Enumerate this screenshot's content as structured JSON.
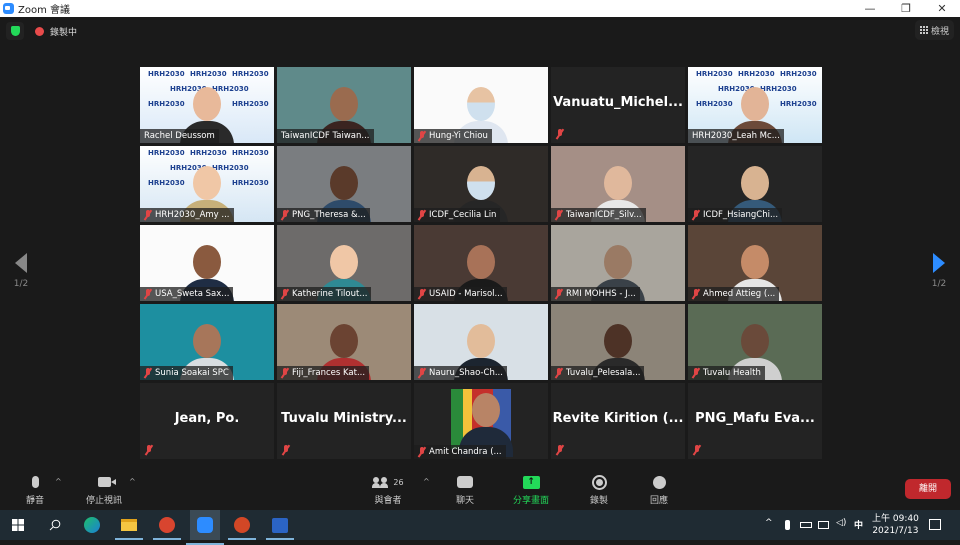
{
  "window": {
    "title": "Zoom 會議",
    "minimize": "—",
    "maximize": "❐",
    "close": "✕"
  },
  "topbar": {
    "recording_label": "錄製中",
    "view_label": "檢視"
  },
  "pagination": {
    "left": "1/2",
    "right": "1/2"
  },
  "tiles": [
    {
      "name": "Rachel Deussom",
      "muted": false,
      "video": true,
      "active": false
    },
    {
      "name": "TaiwanICDF Taiwan...",
      "muted": false,
      "video": true,
      "active": false
    },
    {
      "name": "Hung-Yi Chiou",
      "muted": true,
      "video": true,
      "active": false
    },
    {
      "name": "Vanuatu_Michel...",
      "muted": true,
      "video": false,
      "active": false
    },
    {
      "name": "HRH2030_Leah Mc...",
      "muted": false,
      "video": true,
      "active": true
    },
    {
      "name": "HRH2030_Amy ...",
      "muted": true,
      "video": true,
      "active": false
    },
    {
      "name": "PNG_Theresa &...",
      "muted": true,
      "video": true,
      "active": false
    },
    {
      "name": "ICDF_Cecilia Lin",
      "muted": true,
      "video": true,
      "active": false
    },
    {
      "name": "TaiwanICDF_Silv...",
      "muted": true,
      "video": true,
      "active": false
    },
    {
      "name": "ICDF_HsiangChi...",
      "muted": true,
      "video": true,
      "active": false
    },
    {
      "name": "USA_Sweta Sax...",
      "muted": true,
      "video": true,
      "active": false
    },
    {
      "name": "Katherine Tilout...",
      "muted": true,
      "video": true,
      "active": false
    },
    {
      "name": "USAID - Marisol...",
      "muted": true,
      "video": true,
      "active": false
    },
    {
      "name": "RMI MOHHS - J...",
      "muted": true,
      "video": true,
      "active": false
    },
    {
      "name": "Ahmed Attieg (...",
      "muted": true,
      "video": true,
      "active": false
    },
    {
      "name": "Sunia Soakai SPC",
      "muted": true,
      "video": true,
      "active": false
    },
    {
      "name": "Fiji_Frances Kat...",
      "muted": true,
      "video": true,
      "active": false
    },
    {
      "name": "Nauru_Shao-Ch...",
      "muted": true,
      "video": true,
      "active": false
    },
    {
      "name": "Tuvalu_Pelesala...",
      "muted": true,
      "video": true,
      "active": false
    },
    {
      "name": "Tuvalu Health",
      "muted": true,
      "video": true,
      "active": false
    },
    {
      "name": "Jean, Po.",
      "muted": true,
      "video": false,
      "active": false
    },
    {
      "name": "Tuvalu  Ministry...",
      "muted": true,
      "video": false,
      "active": false
    },
    {
      "name": "Amit Chandra (...",
      "muted": true,
      "video": true,
      "active": false
    },
    {
      "name": "Revite Kirition (...",
      "muted": true,
      "video": false,
      "active": false
    },
    {
      "name": "PNG_Mafu  Eva...",
      "muted": true,
      "video": false,
      "active": false
    }
  ],
  "tile_logo": "HRH2030",
  "toolbar": {
    "mute": "靜音",
    "stop_video": "停止視訊",
    "participants": "與會者",
    "participants_count": "26",
    "chat": "聊天",
    "share_screen": "分享畫面",
    "share_icon": "↑",
    "record": "錄製",
    "reactions": "回應",
    "leave": "離開",
    "caret": "^",
    "share_color": "#23d959",
    "leave_color": "#c0282d"
  },
  "taskbar": {
    "apps": [
      "start",
      "search",
      "edge",
      "file-explorer",
      "remote-desktop",
      "zoom",
      "powerpoint",
      "word"
    ],
    "ime": "中",
    "time": "上午 09:40",
    "date": "2021/7/13",
    "tray_expand": "^"
  }
}
